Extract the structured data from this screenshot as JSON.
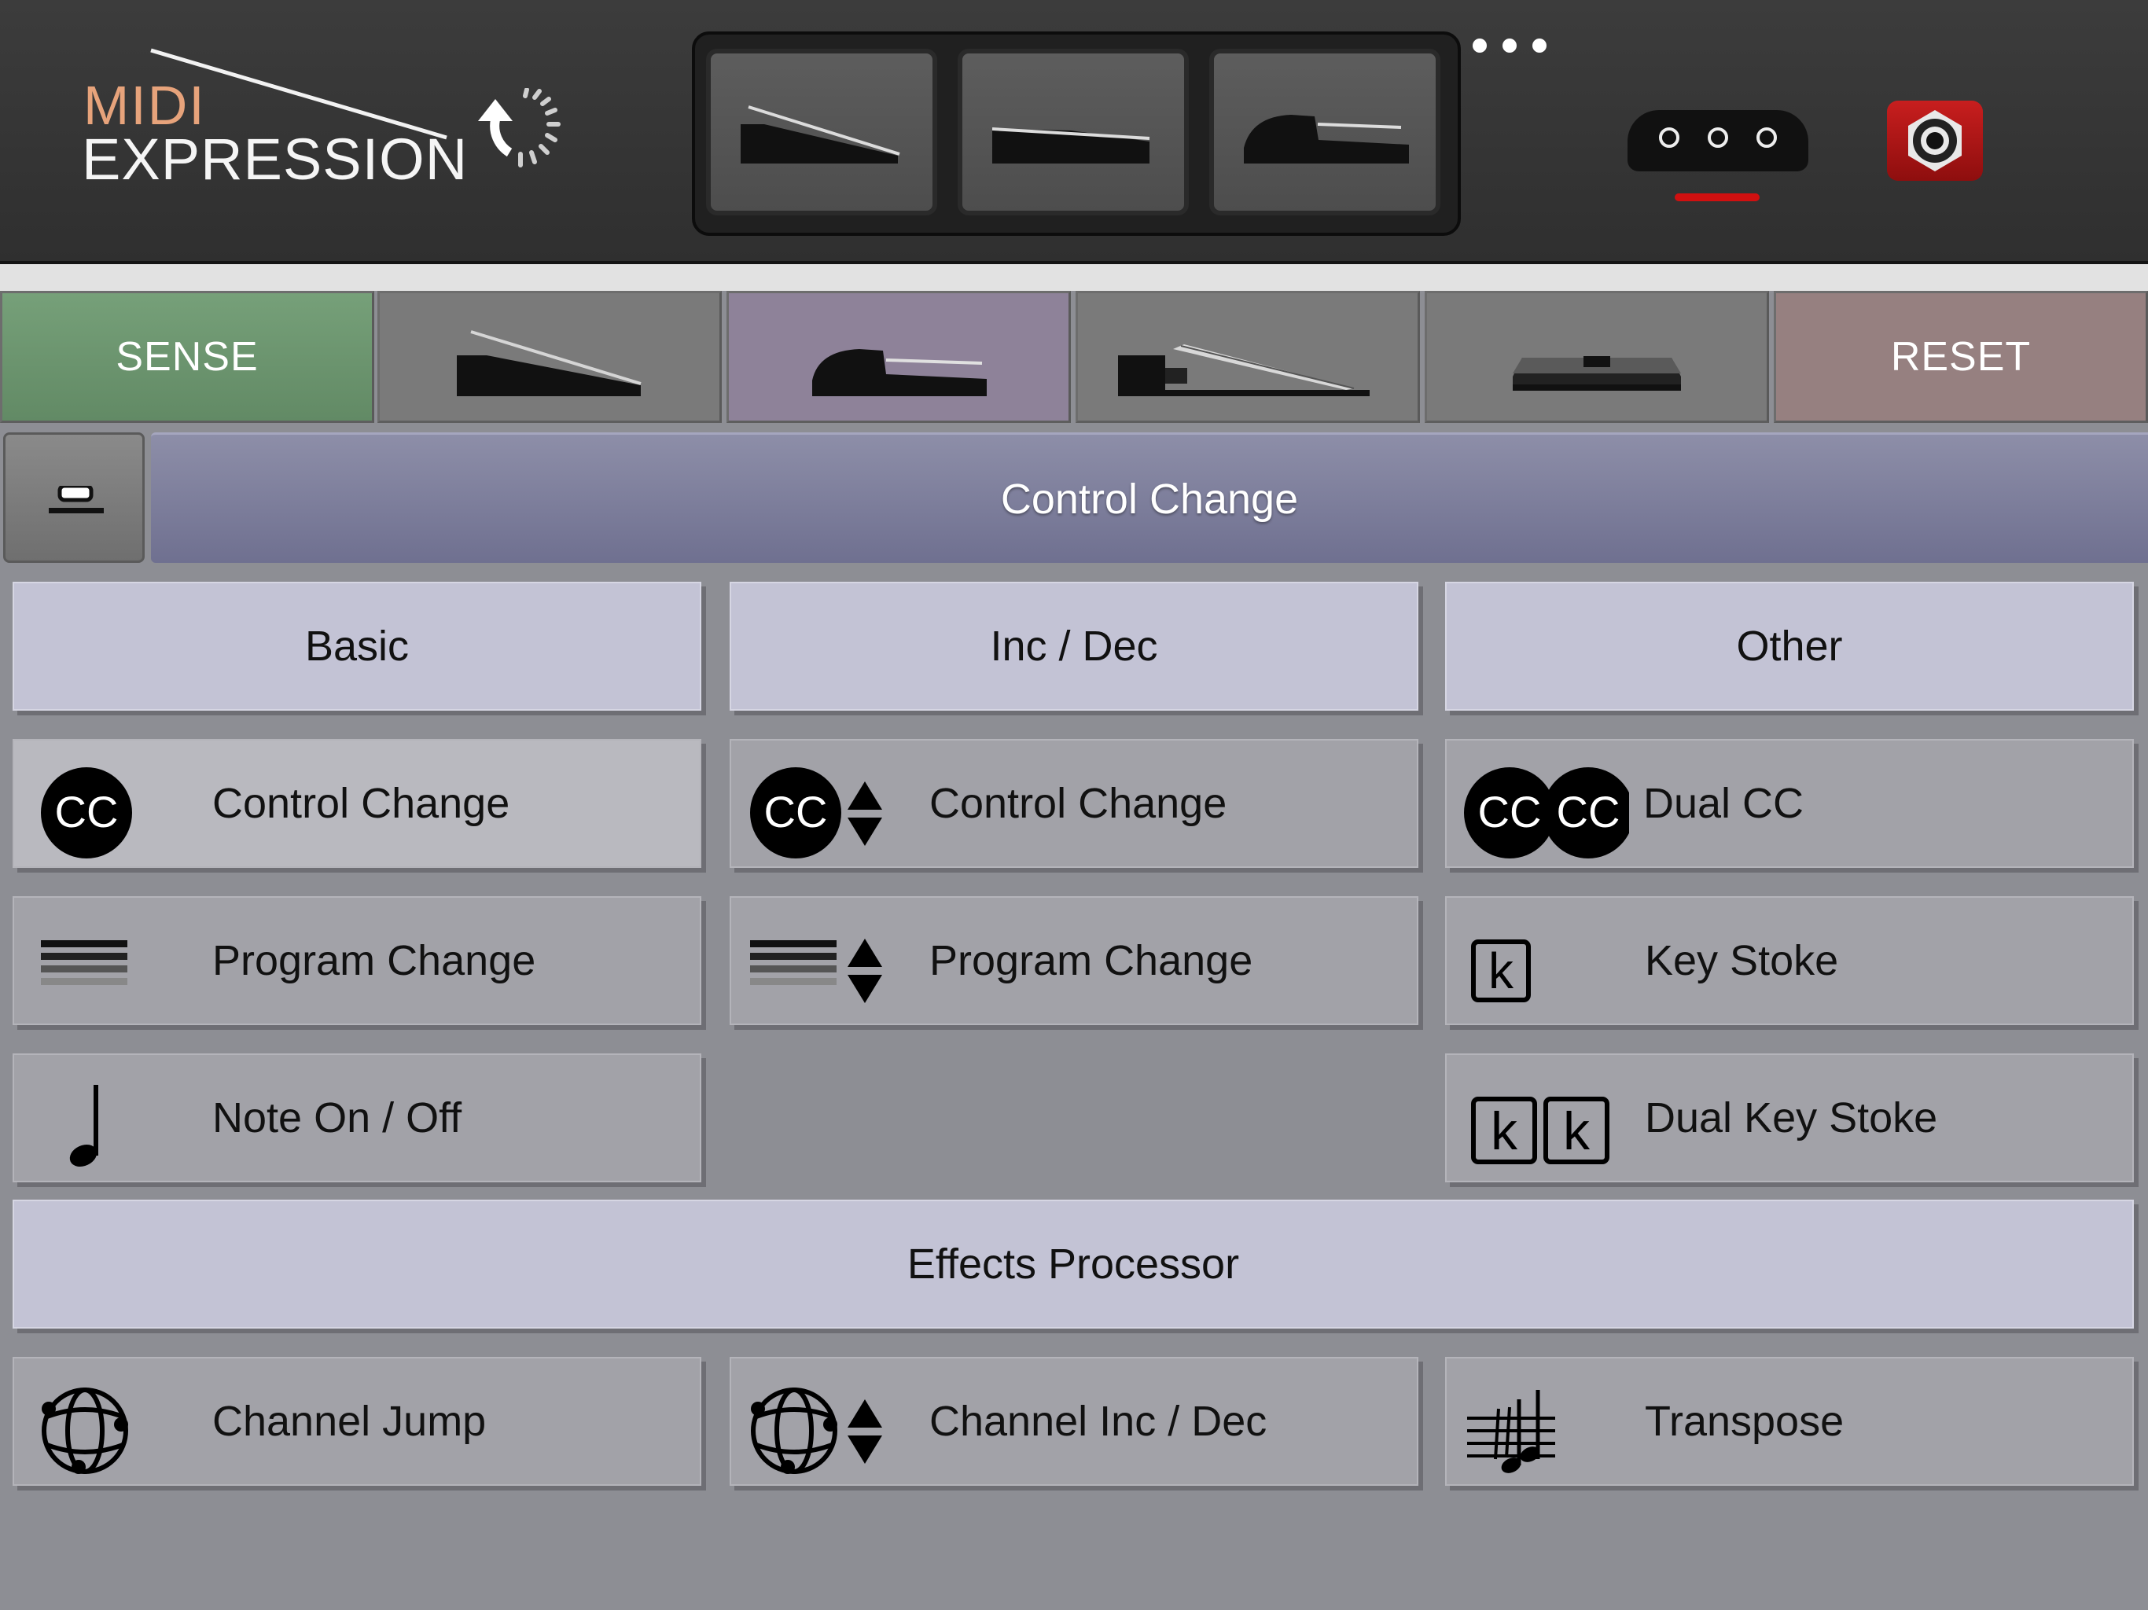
{
  "header": {
    "logo": {
      "line1": "MIDI",
      "line2": "EXPRESSION"
    },
    "pedal_slots": [
      {
        "icon": "expression-pedal-icon"
      },
      {
        "icon": "flat-expression-pedal-icon"
      },
      {
        "icon": "sustain-pedal-icon"
      }
    ],
    "more_icon": "more-dots-icon",
    "midi_port_icon": "midi-port-icon",
    "jack_icon": "audio-jack-icon",
    "colors": {
      "logo_midi": "#e7a37b",
      "led": "#d01010",
      "jack": "#c81e1e"
    }
  },
  "tabs": {
    "sense": {
      "label": "SENSE",
      "color": "#6e9470"
    },
    "reset": {
      "label": "RESET",
      "color": "#968080"
    },
    "pedal_tabs": [
      "expression-pedal-icon",
      "sustain-pedal-icon",
      "piano-pedal-icon",
      "footswitch-icon"
    ],
    "selected_color": "#8e8299"
  },
  "title_bar": {
    "title": "Control Change"
  },
  "categories": {
    "basic": "Basic",
    "incdec": "Inc / Dec",
    "other": "Other",
    "effects": "Effects Processor"
  },
  "items": {
    "basic_cc": {
      "label": "Control Change",
      "icon": "cc-icon",
      "icon_text": "CC"
    },
    "basic_pc": {
      "label": "Program Change",
      "icon": "program-list-icon"
    },
    "basic_note": {
      "label": "Note On / Off",
      "icon": "music-note-icon"
    },
    "inc_cc": {
      "label": "Control Change",
      "icon": "cc-updown-icon",
      "icon_text": "CC"
    },
    "inc_pc": {
      "label": "Program Change",
      "icon": "program-updown-icon"
    },
    "dual_cc": {
      "label": "Dual CC",
      "icon": "dual-cc-icon",
      "icon_text": "CC"
    },
    "key_stoke": {
      "label": "Key Stoke",
      "icon": "key-icon",
      "icon_text": "k"
    },
    "dual_key": {
      "label": "Dual Key Stoke",
      "icon": "dual-key-icon",
      "icon_text": "k"
    },
    "channel_jump": {
      "label": "Channel Jump",
      "icon": "channel-globe-icon"
    },
    "channel_incdec": {
      "label": "Channel Inc / Dec",
      "icon": "channel-globe-updown-icon"
    },
    "transpose": {
      "label": "Transpose",
      "icon": "transpose-icon"
    }
  }
}
